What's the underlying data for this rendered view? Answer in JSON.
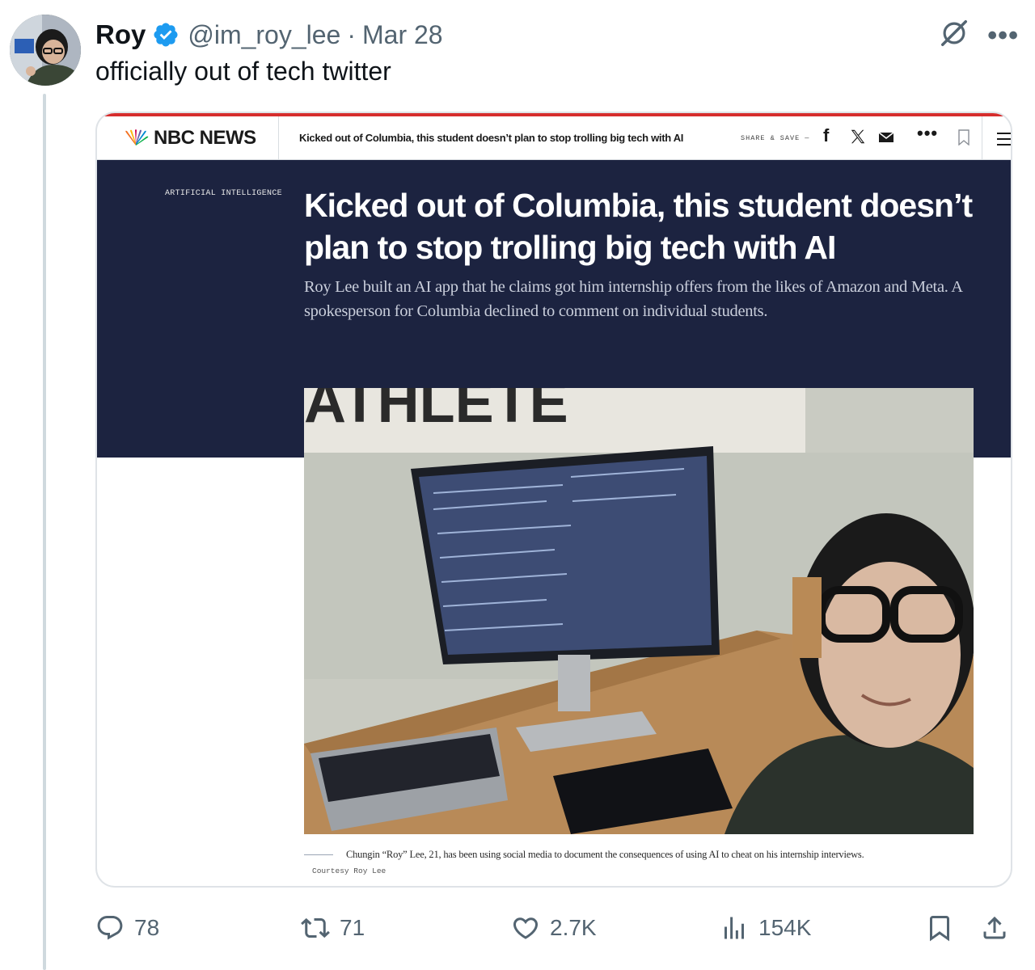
{
  "tweet": {
    "author_name": "Roy",
    "handle": "@im_roy_lee",
    "separator": "·",
    "date": "Mar 28",
    "text": "officially out of tech twitter"
  },
  "article": {
    "brand": "NBC NEWS",
    "nav_headline": "Kicked out of Columbia, this student doesn’t plan to stop trolling big tech with AI",
    "share_label": "SHARE & SAVE —",
    "section": "ARTIFICIAL INTELLIGENCE",
    "title": "Kicked out of Columbia, this student doesn’t plan to stop trolling big tech with AI",
    "dek": "Roy Lee built an AI app that he claims got him internship offers from the likes of Amazon and Meta. A spokesperson for Columbia declined to comment on individual students.",
    "photo_banner_text": "ATHLETE",
    "caption": "Chungin “Roy” Lee, 21, has been using social media to document the consequences of using AI to cheat on his internship interviews.",
    "credit": "Courtesy Roy Lee"
  },
  "metrics": {
    "replies": "78",
    "reposts": "71",
    "likes": "2.7K",
    "views": "154K"
  },
  "colors": {
    "verified_blue": "#1d9bf0",
    "hero_navy": "#1c2340",
    "nbc_red_rule": "#d62d2d",
    "muted_gray": "#536471"
  },
  "icons": [
    "verified-badge-icon",
    "grok-icon",
    "more-icon",
    "facebook-icon",
    "x-logo-icon",
    "mail-icon",
    "bookmark-icon",
    "hamburger-menu-icon",
    "reply-icon",
    "repost-icon",
    "like-icon",
    "views-icon",
    "share-icon"
  ]
}
